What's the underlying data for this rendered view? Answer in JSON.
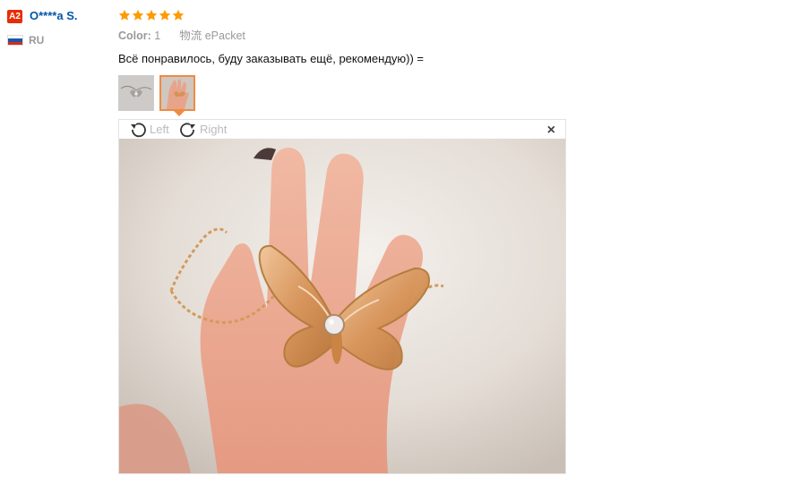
{
  "user": {
    "level_badge": "A2",
    "name": "O****a S.",
    "country": "RU",
    "flag_icon": "russia-flag-icon"
  },
  "rating": {
    "stars": 5,
    "max": 5,
    "color": "#ff9a00"
  },
  "details": {
    "color_label": "Color:",
    "color_value": "1",
    "shipping_label": "物流",
    "shipping_value": "ePacket"
  },
  "review_text": "Всё понравилось, буду заказывать ещё, рекомендую)) =",
  "thumbnails": [
    {
      "name": "thumbnail-butterfly-ring-silver",
      "selected": false
    },
    {
      "name": "thumbnail-butterfly-ring-on-hand",
      "selected": true
    }
  ],
  "viewer": {
    "rotate_left_label": "Left",
    "rotate_right_label": "Right",
    "close_icon": "×"
  },
  "colors": {
    "badge": "#e62e04",
    "username": "#0056a8",
    "selected_thumb_border": "#f08a42"
  }
}
